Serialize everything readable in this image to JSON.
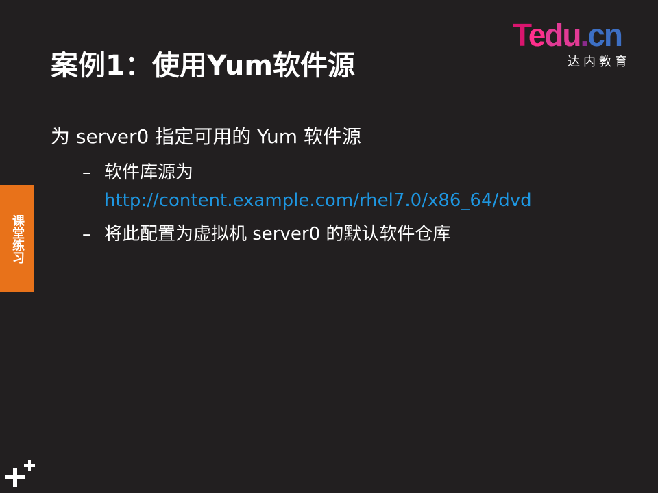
{
  "slide": {
    "title": "案例1：使用Yum软件源",
    "logo": {
      "wordmark_t": "T",
      "wordmark_e": "e",
      "wordmark_du": "du",
      "wordmark_dot": ".",
      "wordmark_cn": "cn",
      "subtitle": "达内教育"
    },
    "side_tab": "课堂练习",
    "bullet_main": "为 server0 指定可用的 Yum 软件源",
    "sub_items": [
      {
        "dash": "–",
        "text": "软件库源为",
        "url": "http://content.example.com/rhel7.0/x86_64/dvd"
      },
      {
        "dash": "–",
        "text": "将此配置为虚拟机 server0 的默认软件仓库"
      }
    ],
    "colors": {
      "background": "#221f20",
      "accent_orange": "#e8721a",
      "link_blue": "#1e96e0"
    }
  }
}
